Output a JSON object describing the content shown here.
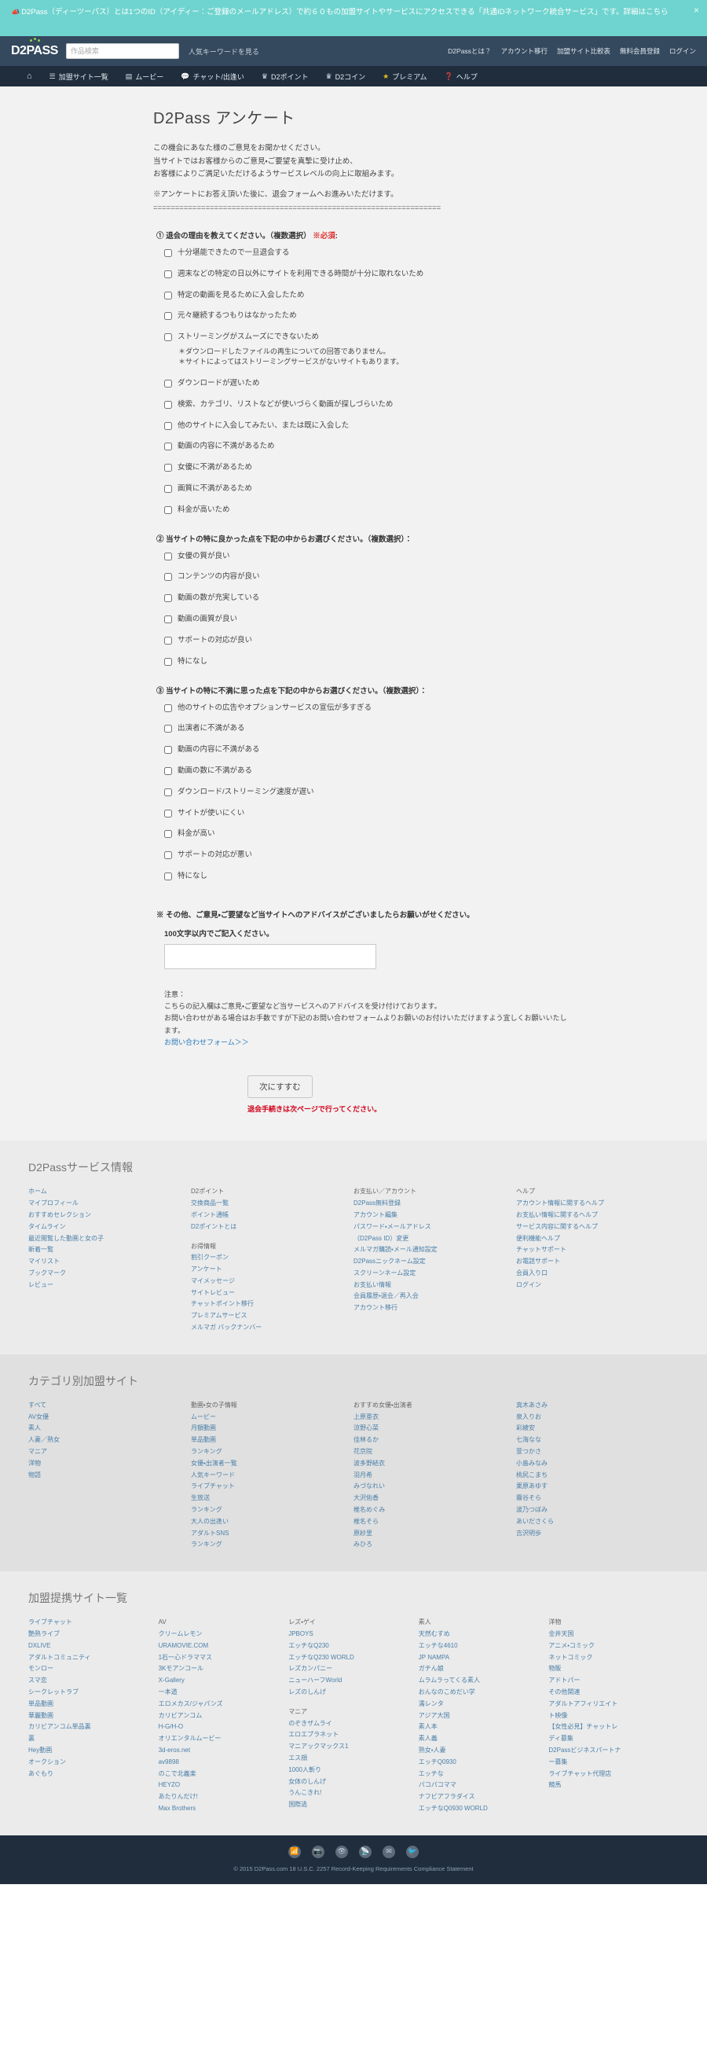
{
  "notice": {
    "icon": "megaphone-icon",
    "text": "D2Pass（ディーツーパス）とは1つのID（アイディー：ご登録のメールアドレス）で約６０もの加盟サイトやサービスにアクセスできる「共通IDネットワーク統合サービス」です。詳細はこちら",
    "close_label": "×"
  },
  "header": {
    "logo": "D2PASS",
    "search_placeholder": "作品検索",
    "search_value": "",
    "hot_keyword": "人気キーワードを見る",
    "links": [
      "D2Passとは？",
      "アカウント移行",
      "加盟サイト比較表",
      "無料会員登録",
      "ログイン"
    ]
  },
  "nav": [
    {
      "icon": "home-icon",
      "label": ""
    },
    {
      "icon": "list-icon",
      "label": "加盟サイト一覧"
    },
    {
      "icon": "film-icon",
      "label": "ムービー"
    },
    {
      "icon": "chat-icon",
      "label": "チャット/出逢い"
    },
    {
      "icon": "trophy-icon",
      "label": "D2ポイント"
    },
    {
      "icon": "trophy-icon",
      "label": "D2コイン"
    },
    {
      "icon": "star-icon",
      "label": "プレミアム"
    },
    {
      "icon": "help-icon",
      "label": "ヘルプ"
    }
  ],
  "main": {
    "title": "D2Pass アンケート",
    "intro_lines": [
      "この機会にあなた様のご意見をお聞かせください。",
      "当サイトではお客様からのご意見・ご要望を真摯に受け止め、",
      "お客様によりご満足いただけるようサービスレベルの向上に取組みます。"
    ],
    "intro_note": "※アンケートにお答え頂いた後に、退会フォームへお進みいただけます。",
    "divider": "==================================================================",
    "q1": {
      "label": "① 退会の理由を教えてください。（複数選択）",
      "required": "※必須",
      "colon": ":",
      "options": [
        "十分堪能できたので一旦退会する",
        "週末などの特定の日以外にサイトを利用できる時間が十分に取れないため",
        "特定の動画を見るために入会したため",
        "元々継続するつもりはなかったため",
        "ストリーミングがスムーズにできないため",
        "ダウンロードが遅いため",
        "検索、カテゴリ、リストなどが使いづらく動画が探しづらいため",
        "他のサイトに入会してみたい、または既に入会した",
        "動画の内容に不満があるため",
        "女優に不満があるため",
        "画質に不満があるため",
        "料金が高いため"
      ],
      "stream_notes": [
        "＊ダウンロードしたファイルの再生についての回答でありません。",
        "＊サイトによってはストリーミングサービスがないサイトもあります。"
      ]
    },
    "q2": {
      "label": "② 当サイトの特に良かった点を下記の中からお選びください。（複数選択）：",
      "options": [
        "女優の質が良い",
        "コンテンツの内容が良い",
        "動画の数が充実している",
        "動画の画質が良い",
        "サポートの対応が良い",
        "特になし"
      ]
    },
    "q3": {
      "label": "③ 当サイトの特に不満に思った点を下記の中からお選びください。（複数選択）：",
      "options": [
        "他のサイトの広告やオプションサービスの宣伝が多すぎる",
        "出演者に不満がある",
        "動画の内容に不満がある",
        "動画の数に不満がある",
        "ダウンロード/ストリーミング速度が遅い",
        "サイトが使いにくい",
        "料金が高い",
        "サポートの対応が悪い",
        "特になし"
      ]
    },
    "q4": {
      "label": "※ その他、ご意見・ご要望など当サイトへのアドバイスがございましたらお願いがせください。",
      "sub": "100文字以内でご記入ください。",
      "value": ""
    },
    "caution": {
      "title": "注意：",
      "line1": "こちらの記入欄はご意見・ご要望など当サービスへのアドバイスを受け付けております。",
      "line2": "お問い合わせがある場合はお手数ですが下記のお問い合わせフォームよりお願いのお付けいただけますよう宜しくお願いいたします。",
      "link": "お問い合わせフォーム＞＞"
    },
    "submit": {
      "label": "次にすすむ",
      "note": "退会手続きは次ページで行ってください。"
    }
  },
  "footer_service": {
    "title": "D2Passサービス情報",
    "columns": [
      {
        "groups": [
          {
            "header": "",
            "items": [
              "ホーム",
              "マイプロフィール",
              "おすすめセレクション",
              "タイムライン",
              "最近閲覧した動画と女の子",
              "新着一覧"
            ]
          },
          {
            "header": "",
            "items": [
              "マイリスト",
              "ブックマーク",
              "レビュー"
            ]
          }
        ]
      },
      {
        "groups": [
          {
            "header": "D2ポイント",
            "items": [
              "交換商品一覧",
              "ポイント通帳",
              "D2ポイントとは"
            ]
          },
          {
            "header": "お得情報",
            "items": [
              "割引クーポン",
              "アンケート",
              "マイメッセージ",
              "サイトレビュー",
              "チャットポイント移行",
              "プレミアムサービス",
              "メルマガ バックナンバー"
            ]
          }
        ]
      },
      {
        "groups": [
          {
            "header": "お支払い／アカウント",
            "items": [
              "D2Pass無料登録",
              "アカウント編集",
              "パスワード・メールアドレス",
              "（D2Pass ID）変更",
              "メルマガ購読・メール通知設定",
              "D2Passニックネーム設定",
              "スクリーンネーム設定",
              "お支払い情報",
              "会員履歴・退会／再入会",
              "アカウント移行"
            ]
          }
        ]
      },
      {
        "groups": [
          {
            "header": "ヘルプ",
            "items": [
              "アカウント情報に関するヘルプ",
              "お支払い情報に関するヘルプ",
              "サービス内容に関するヘルプ",
              "便利機能ヘルプ",
              "チャットサポート",
              "お電話サポート"
            ]
          },
          {
            "header": "",
            "items": [
              "会員入り口",
              "ログイン"
            ]
          }
        ]
      }
    ]
  },
  "footer_category": {
    "title": "カテゴリ別加盟サイト",
    "columns": [
      {
        "header": "",
        "items": [
          "すべて",
          "AV女優",
          "素人",
          "人妻／熟女",
          "マニア",
          "洋物",
          "物語"
        ]
      },
      {
        "header": "動画・女の子情報",
        "items": [
          "ムービー",
          "月額動画",
          "単品動画",
          "ランキング",
          "女優・出演者一覧",
          "人気キーワード",
          "ライブチャット",
          "生放送",
          "ランキング",
          "大人の出逢い",
          "アダルトSNS",
          "ランキング"
        ]
      },
      {
        "header": "おすすめ女優・出演者",
        "items": [
          "上原亜衣",
          "涼野心菜",
          "佳林るか",
          "花京院",
          "波多野結衣",
          "羽月希",
          "みづなれい",
          "大沢佑香",
          "椎名めぐみ",
          "椎名そら",
          "原紗里",
          "みひろ"
        ]
      },
      {
        "header": "",
        "items": [
          "真木あさみ",
          "泉入りお",
          "彩綾安",
          "七海なな",
          "萱つかさ",
          "小島みなみ",
          "桃尻こまち",
          "栗原あゆす",
          "霧谷そら",
          "波乃つぼみ",
          "あいださくら",
          "吉沢明歩"
        ]
      }
    ]
  },
  "footer_partners": {
    "title": "加盟提携サイト一覧",
    "columns": [
      {
        "groups": [
          {
            "header": "",
            "items": [
              "ライブチャット",
              "艶熟ライブ",
              "DXLIVE"
            ]
          },
          {
            "header": "",
            "items": [
              "アダルトコミュニティ",
              "モンロー",
              "スマ恋",
              "シークレットラブ"
            ]
          },
          {
            "header": "",
            "items": [
              "単品動画",
              "華麗動画",
              "カリビアンコム単品裏",
              "裏",
              "Hey動画"
            ]
          },
          {
            "header": "",
            "items": [
              "オークション",
              "あぐもり"
            ]
          }
        ]
      },
      {
        "groups": [
          {
            "header": "AV",
            "items": [
              "クリームレモン",
              "URAMOVIE.COM",
              "1石一心ドラママス",
              "3Kモアンコール",
              "X-Gallery",
              "一本道",
              "エロメカス/ジャパンズ",
              "カリビアンコム",
              "H-G/H-O",
              "オリエンタルムービー",
              "3d-eros.net",
              "av9898",
              "のこで北義楽",
              "HEYZO",
              "あたりんだけ!",
              "Max Brothers"
            ]
          }
        ]
      },
      {
        "groups": [
          {
            "header": "レズ・ゲイ",
            "items": [
              "JPBOYS",
              "エッチなQ230",
              "エッチなQ230 WORLD",
              "レズカンパニー",
              "ニューハーフWorld",
              "レズのしんげ"
            ]
          },
          {
            "header": "マニア",
            "items": [
              "のぞきザムライ",
              "エロエプラネット",
              "マニアックマックス1",
              "エス顔",
              "1000人斬り",
              "女体のしんげ",
              "うんこきれ!",
              "国際逃"
            ]
          }
        ]
      },
      {
        "groups": [
          {
            "header": "素人",
            "items": [
              "天然むすめ",
              "エッチな4610",
              "JP NAMPA",
              "ガチん娘",
              "ムラムラってくる素人",
              "おんなのこめだい学",
              "濡レンタ",
              "アジア大国",
              "素人本",
              "素人義",
              "熟女・人妻",
              "エッチQ0930",
              "エッチな",
              "パコパコママ",
              "ナフビアフラダイス",
              "エッチなQ0930 WORLD"
            ]
          }
        ]
      },
      {
        "groups": [
          {
            "header": "洋物",
            "items": [
              "金井天国"
            ]
          },
          {
            "header": "",
            "items": [
              "アニメ・コミック",
              "ネットコミック"
            ]
          },
          {
            "header": "",
            "items": [
              "物販",
              "アドトパー"
            ]
          },
          {
            "header": "",
            "items": [
              "その他関連",
              "アダルトアフィリエイト",
              "ト映像",
              "【女性必見】チャットレ",
              "ディ募集",
              "D2Passビジネスパートナ",
              "ー募集",
              "ライブチャット代理店",
              "競馬"
            ]
          }
        ]
      }
    ]
  },
  "bottom": {
    "social_icons": [
      "rss-icon",
      "camera-icon",
      "eye-icon",
      "rss2-icon",
      "mail-icon",
      "twitter-icon"
    ],
    "copyright": "© 2015 D2Pass.com 18 U.S.C. 2257 Record-Keeping Requirements Compliance Statement"
  }
}
